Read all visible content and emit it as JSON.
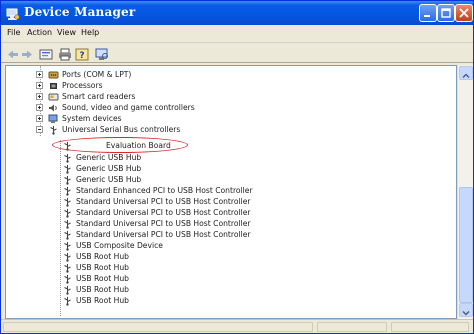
{
  "window": {
    "title": "Device Manager",
    "title_icon": "computer-management-icon",
    "controls": [
      "minimize-icon",
      "maximize-icon",
      "close-icon"
    ]
  },
  "menu": {
    "items": [
      "File",
      "Action",
      "View",
      "Help"
    ]
  },
  "toolbar": {
    "buttons": [
      "back-arrow-icon",
      "forward-arrow-icon",
      "properties-icon",
      "print-icon",
      "help-icon",
      "scan-hardware-icon"
    ]
  },
  "tree": {
    "categories": [
      {
        "label": "Ports (COM & LPT)",
        "icon": "port-icon",
        "state": "collapsed"
      },
      {
        "label": "Processors",
        "icon": "processor-icon",
        "state": "collapsed"
      },
      {
        "label": "Smart card readers",
        "icon": "smart-card-icon",
        "state": "collapsed"
      },
      {
        "label": "Sound, video and game controllers",
        "icon": "sound-icon",
        "state": "collapsed"
      },
      {
        "label": "System devices",
        "icon": "system-device-icon",
        "state": "collapsed"
      },
      {
        "label": "Universal Serial Bus controllers",
        "icon": "usb-controller-icon",
        "state": "expanded"
      }
    ],
    "usb_devices": [
      {
        "label": "Evaluation Board",
        "highlighted": true
      },
      {
        "label": "Generic USB Hub"
      },
      {
        "label": "Generic USB Hub"
      },
      {
        "label": "Generic USB Hub"
      },
      {
        "label": "Standard Enhanced PCI to USB Host Controller"
      },
      {
        "label": "Standard Universal PCI to USB Host Controller"
      },
      {
        "label": "Standard Universal PCI to USB Host Controller"
      },
      {
        "label": "Standard Universal PCI to USB Host Controller"
      },
      {
        "label": "Standard Universal PCI to USB Host Controller"
      },
      {
        "label": "USB Composite Device"
      },
      {
        "label": "USB Root Hub"
      },
      {
        "label": "USB Root Hub"
      },
      {
        "label": "USB Root Hub"
      },
      {
        "label": "USB Root Hub"
      },
      {
        "label": "USB Root Hub"
      }
    ]
  },
  "colors": {
    "titlebar": "#0555e0",
    "highlight_ellipse": "#d9262b",
    "scrollbar": "#c6d8fb"
  }
}
